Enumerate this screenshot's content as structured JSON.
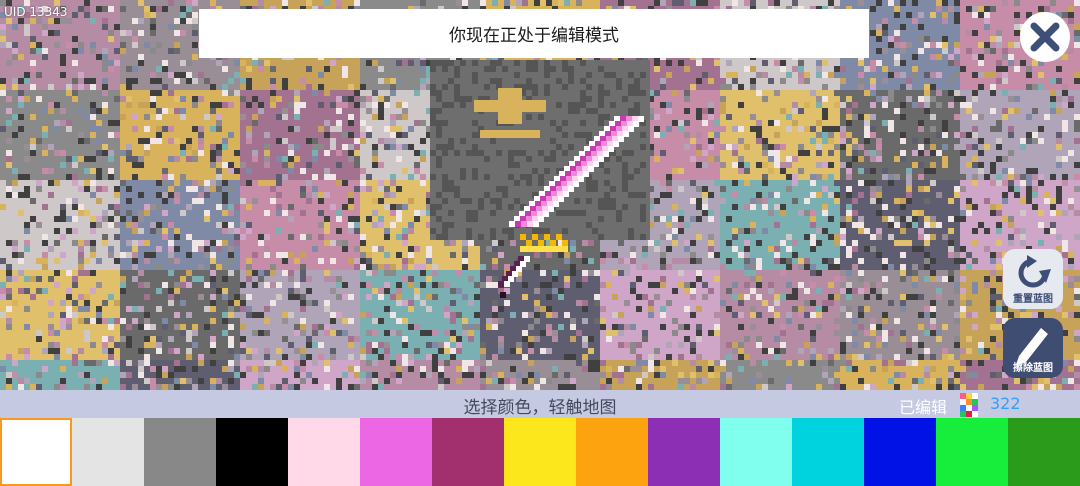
{
  "header": {
    "uid": "UID 13343",
    "mode_banner": "你现在正处于编辑模式"
  },
  "buttons": {
    "close_icon": "close-x-icon",
    "reset": {
      "label": "重置蓝图",
      "icon": "rotate-icon"
    },
    "erase": {
      "label": "擦除蓝图",
      "icon": "pencil-icon"
    }
  },
  "footer": {
    "hint": "选择颜色，轻触地图",
    "edited_label": "已编辑",
    "edited_count": "322"
  },
  "palette": {
    "selected_index": 0,
    "colors": [
      "#ffffff",
      "#e4e4e4",
      "#888888",
      "#000000",
      "#ffd9e8",
      "#ec67e4",
      "#a3306e",
      "#fce71c",
      "#fda30f",
      "#8c2fb4",
      "#80ffee",
      "#00d3dd",
      "#0012e6",
      "#17ee3c",
      "#2a9b1a"
    ]
  }
}
